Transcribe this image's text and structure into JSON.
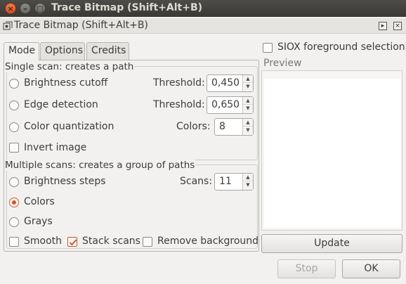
{
  "window": {
    "title": "Trace Bitmap (Shift+Alt+B)",
    "close_glyph": "×",
    "min_glyph": "–",
    "max_glyph": "□"
  },
  "dock": {
    "title": "Trace Bitmap (Shift+Alt+B)",
    "btn1_glyph": "▸",
    "btn2_glyph": "×"
  },
  "tabs": [
    {
      "label": "Mode",
      "active": true
    },
    {
      "label": "Options",
      "active": false
    },
    {
      "label": "Credits",
      "active": false
    }
  ],
  "single_scan": {
    "frame_label": "Single scan: creates a path",
    "brightness": {
      "label": "Brightness cutoff",
      "selected": false,
      "param_label": "Threshold:",
      "value": "0,450"
    },
    "edge": {
      "label": "Edge detection",
      "selected": false,
      "param_label": "Threshold:",
      "value": "0,650"
    },
    "quant": {
      "label": "Color quantization",
      "selected": false,
      "param_label": "Colors:",
      "value": "8"
    },
    "invert": {
      "label": "Invert image",
      "checked": false
    }
  },
  "multi_scan": {
    "frame_label": "Multiple scans: creates a group of paths",
    "brightness_steps": {
      "label": "Brightness steps",
      "selected": false,
      "param_label": "Scans:",
      "value": "11"
    },
    "colors": {
      "label": "Colors",
      "selected": true
    },
    "grays": {
      "label": "Grays",
      "selected": false
    },
    "smooth": {
      "label": "Smooth",
      "checked": false
    },
    "stack": {
      "label": "Stack scans",
      "checked": true
    },
    "remove_bg": {
      "label": "Remove background",
      "checked": false
    }
  },
  "siox": {
    "label": "SIOX foreground selection",
    "checked": false
  },
  "preview": {
    "label": "Preview"
  },
  "buttons": {
    "update": "Update",
    "stop": "Stop",
    "ok": "OK"
  },
  "colors": {
    "accent": "#d6552a",
    "titlebar": "#3c3b37",
    "background": "#f2f1f0"
  }
}
